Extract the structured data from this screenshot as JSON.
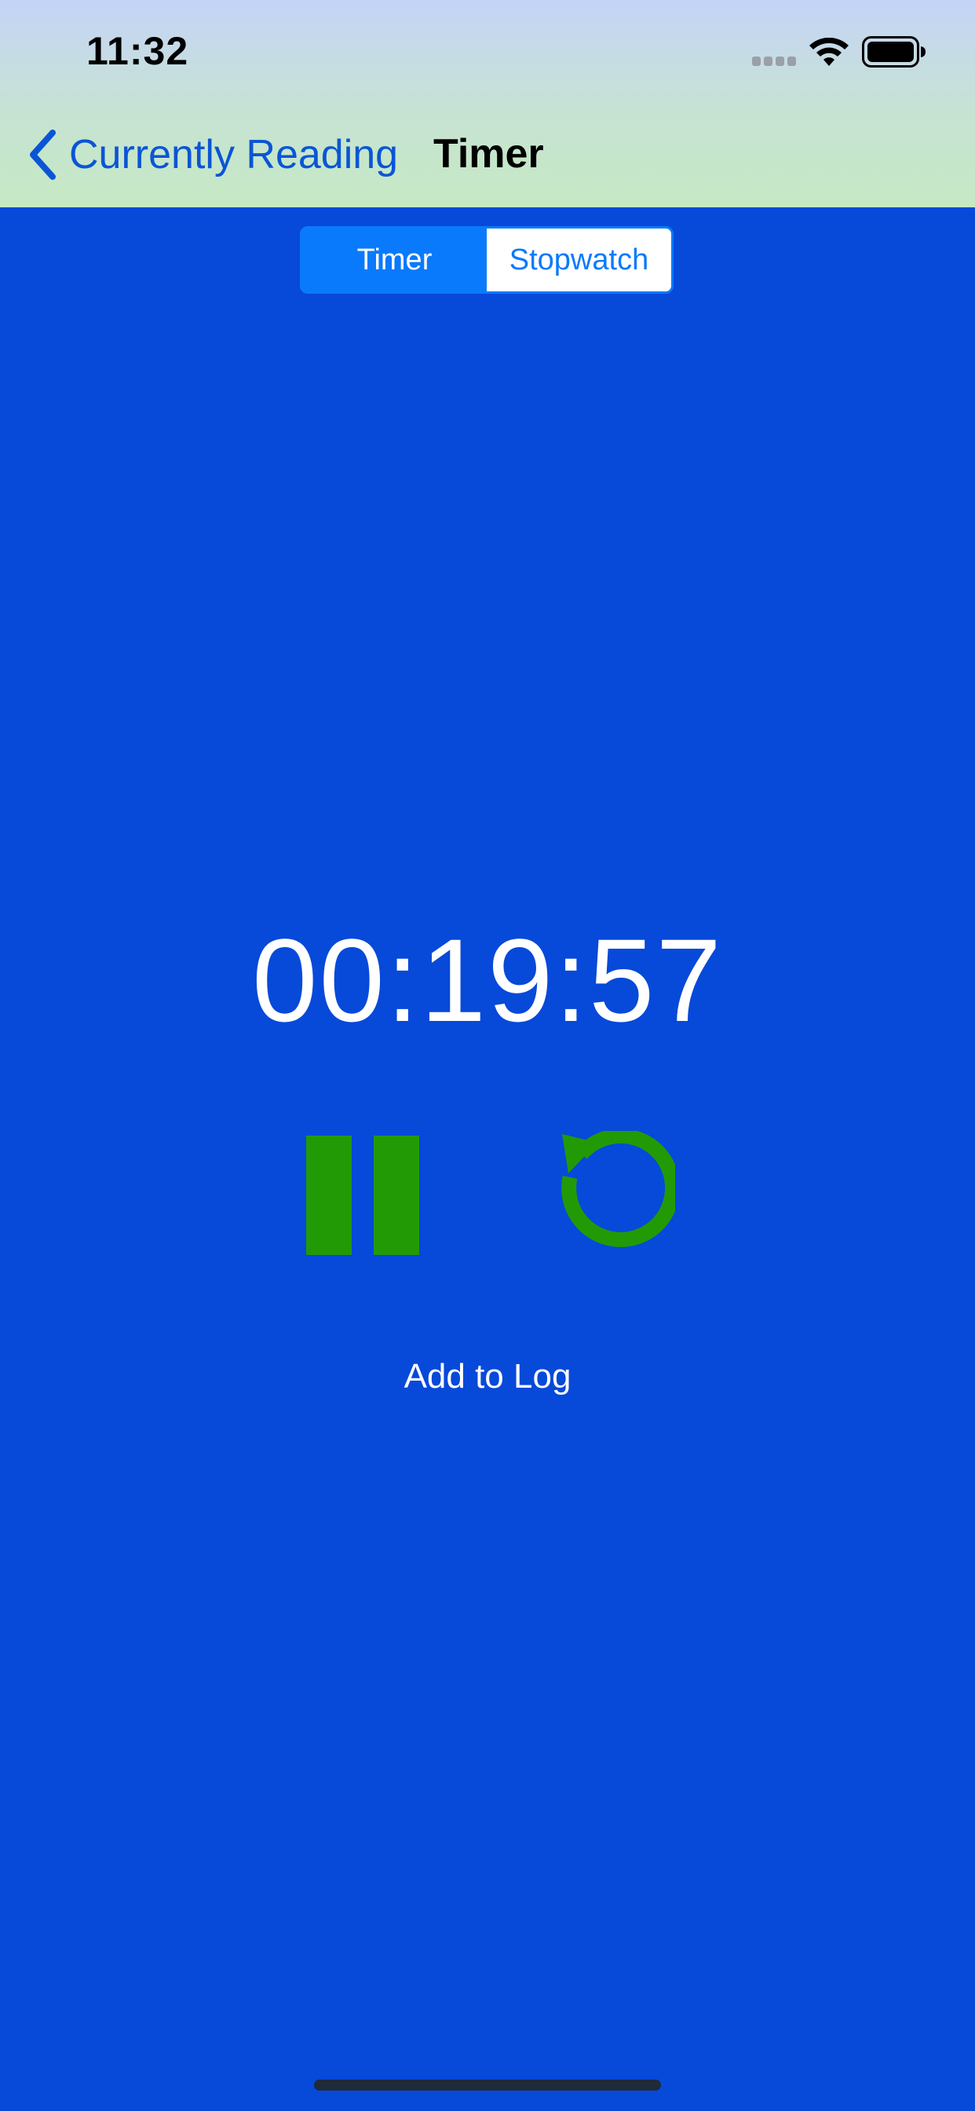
{
  "status_bar": {
    "time": "11:32",
    "icons": [
      "cellular-signal-icon",
      "wifi-icon",
      "battery-icon"
    ]
  },
  "nav": {
    "back_label": "Currently Reading",
    "title": "Timer",
    "back_icon": "chevron-left-icon"
  },
  "segmented_control": {
    "options": [
      "Timer",
      "Stopwatch"
    ],
    "selected": "Timer"
  },
  "timer": {
    "display": "00:19:57"
  },
  "controls": {
    "pause_icon": "pause-icon",
    "reset_icon": "reset-icon",
    "add_to_log_label": "Add to Log"
  },
  "colors": {
    "background": "#0749d9",
    "accent": "#0a7afc",
    "control_green": "#229a06",
    "link_blue": "#0a55d6"
  }
}
